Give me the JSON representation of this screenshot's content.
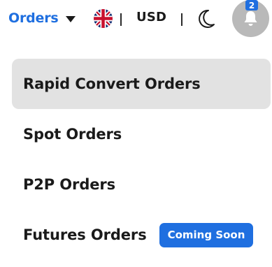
{
  "header": {
    "orders_label": "Orders",
    "currency": "USD",
    "notifications_count": "2",
    "flag": "uk-flag-icon",
    "theme_icon": "moon-icon",
    "bell_icon": "bell-icon"
  },
  "menu": {
    "items": [
      {
        "label": "Rapid Convert Orders",
        "active": true
      },
      {
        "label": "Spot Orders"
      },
      {
        "label": "P2P Orders"
      },
      {
        "label": "Futures Orders",
        "badge": "Coming Soon"
      }
    ]
  },
  "colors": {
    "accent": "#1f6fe0",
    "active_bg": "#e2e2e2",
    "bell_bg": "#b9b9b9",
    "text": "#1a1a1a"
  }
}
